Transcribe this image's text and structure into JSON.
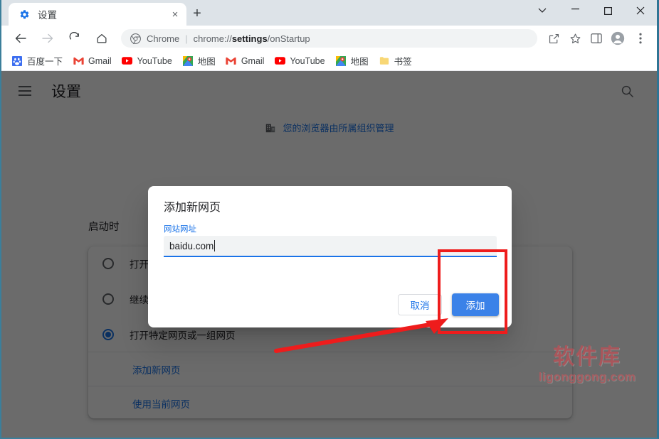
{
  "window": {
    "controls": {
      "tab_search": "tab-search-chevron",
      "minimize": "minimize",
      "maximize": "maximize",
      "close": "close"
    }
  },
  "tabstrip": {
    "tabs": [
      {
        "title": "设置",
        "favicon": "gear-icon",
        "close_label": "×"
      }
    ],
    "new_tab_label": "+"
  },
  "toolbar": {
    "back_label": "←",
    "forward_label": "→",
    "reload_label": "⟳",
    "home_label": "⌂",
    "omnibox": {
      "badge_icon": "chrome-logo-icon",
      "scheme": "Chrome",
      "separator": "|",
      "url_prefix": "chrome://",
      "url_bold": "settings",
      "url_suffix": "/onStartup"
    },
    "share_icon": "share-icon",
    "bookmark_icon": "star-icon",
    "sidepanel_icon": "side-panel-icon",
    "profile_icon": "profile-avatar-icon",
    "menu_icon": "three-dot-menu-icon"
  },
  "bookmarks": [
    {
      "label": "百度一下",
      "icon": "baidu-icon"
    },
    {
      "label": "Gmail",
      "icon": "gmail-icon"
    },
    {
      "label": "YouTube",
      "icon": "youtube-icon"
    },
    {
      "label": "地图",
      "icon": "maps-icon"
    },
    {
      "label": "Gmail",
      "icon": "gmail-icon"
    },
    {
      "label": "YouTube",
      "icon": "youtube-icon"
    },
    {
      "label": "地图",
      "icon": "maps-icon"
    },
    {
      "label": "书签",
      "icon": "folder-icon"
    }
  ],
  "settings_page": {
    "menu_icon": "hamburger-menu-icon",
    "title": "设置",
    "search_icon": "search-icon",
    "managed_banner": {
      "icon": "business-building-icon",
      "text": "您的浏览器由所属组织管理"
    },
    "section_title": "启动时",
    "startup_options": [
      {
        "label": "打开新标签页",
        "checked": false
      },
      {
        "label": "继续浏览上次打开的网页",
        "checked": false
      },
      {
        "label": "打开特定网页或一组网页",
        "checked": true
      }
    ],
    "links": [
      {
        "label": "添加新网页"
      },
      {
        "label": "使用当前网页"
      }
    ]
  },
  "dialog": {
    "title": "添加新网页",
    "field_label": "网站网址",
    "input_value": "baidu.com",
    "input_placeholder": "",
    "cancel_label": "取消",
    "add_label": "添加"
  },
  "annotations": {
    "highlight_box": "add-button-highlight",
    "arrow": "pointer-arrow"
  },
  "watermark": {
    "cn": "软件库",
    "en": "ligonggong.com"
  },
  "colors": {
    "accent_blue": "#1a73e8",
    "button_blue": "#3b82e8",
    "annotation_red": "#ee1c1c",
    "overlay": "rgba(0,0,0,0.58)",
    "toolbar_bg": "#ffffff",
    "frame_bg": "#dde3e8"
  }
}
